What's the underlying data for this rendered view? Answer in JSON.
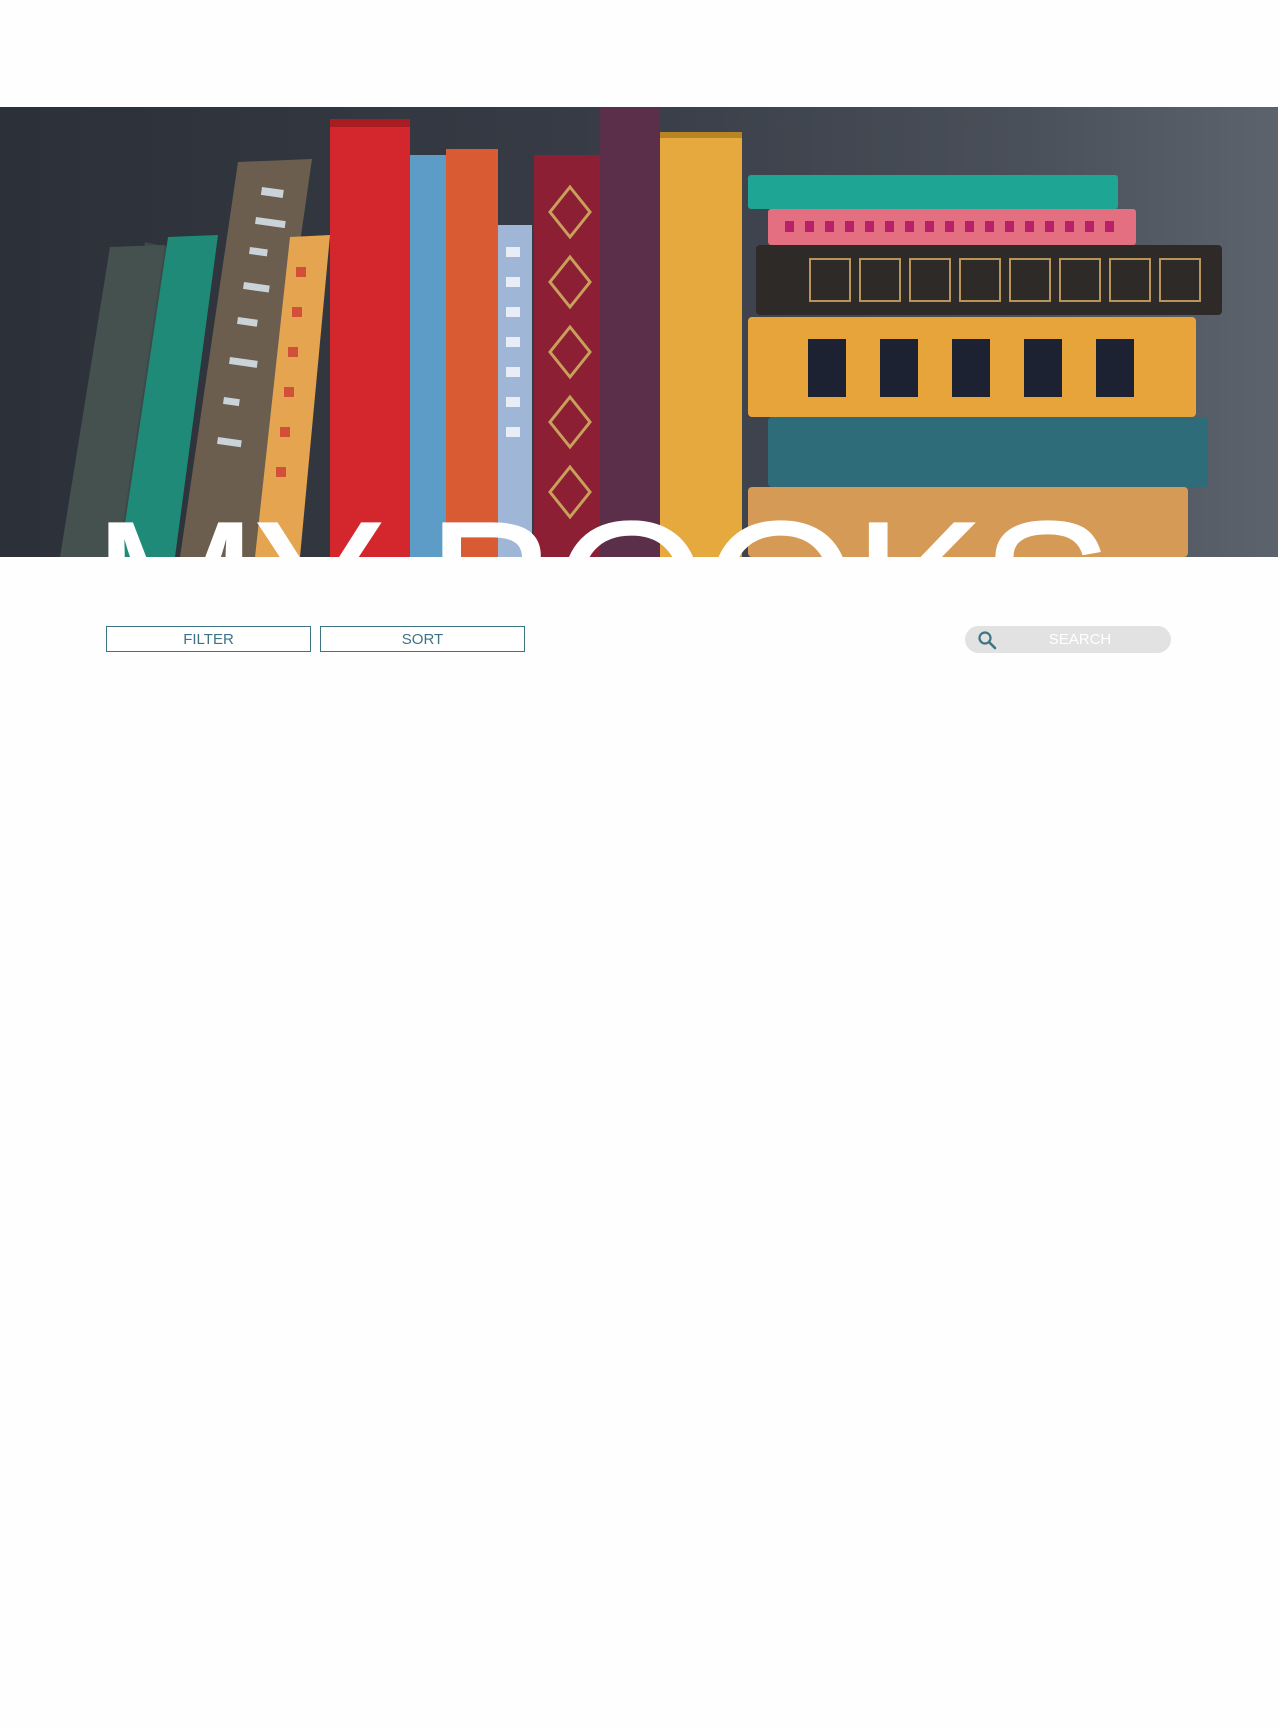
{
  "hero": {
    "title": "MY BOOKS",
    "image_icon": "bookshelf-photo"
  },
  "toolbar": {
    "filter_label": "FILTER",
    "sort_label": "SORT"
  },
  "search": {
    "placeholder": "SEARCH",
    "value": "",
    "icon": "search-icon"
  },
  "colors": {
    "accent": "#3d7484",
    "search_bg": "#e2e2e2",
    "hero_bg": "#2c3038"
  }
}
